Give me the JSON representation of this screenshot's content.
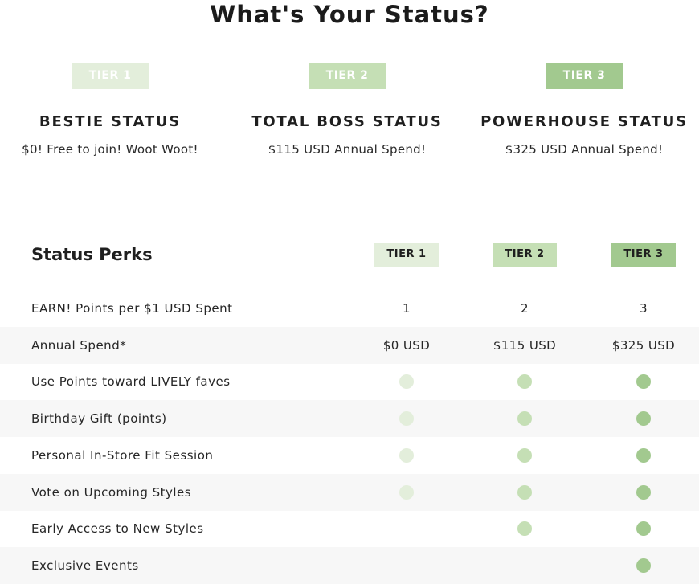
{
  "page_title": "What's Your Status?",
  "colors": {
    "tier1": "#e3eedb",
    "tier2": "#c5dfb5",
    "tier3": "#a2c98f"
  },
  "tiers": [
    {
      "badge": "TIER 1",
      "name": "BESTIE STATUS",
      "spend": "$0! Free to join! Woot Woot!"
    },
    {
      "badge": "TIER 2",
      "name": "TOTAL BOSS STATUS",
      "spend": "$115 USD Annual Spend!"
    },
    {
      "badge": "TIER 3",
      "name": "POWERHOUSE STATUS",
      "spend": "$325 USD Annual Spend!"
    }
  ],
  "perks": {
    "title": "Status Perks",
    "headers": [
      "TIER 1",
      "TIER 2",
      "TIER 3"
    ],
    "rows": [
      {
        "label": "EARN! Points per $1 USD Spent",
        "values": [
          "1",
          "2",
          "3"
        ]
      },
      {
        "label": "Annual Spend*",
        "values": [
          "$0 USD",
          "$115 USD",
          "$325 USD"
        ]
      },
      {
        "label": "Use Points toward LIVELY faves",
        "checks": [
          true,
          true,
          true
        ]
      },
      {
        "label": "Birthday Gift (points)",
        "checks": [
          true,
          true,
          true
        ]
      },
      {
        "label": "Personal In-Store Fit Session",
        "checks": [
          true,
          true,
          true
        ]
      },
      {
        "label": "Vote on Upcoming Styles",
        "checks": [
          true,
          true,
          true
        ]
      },
      {
        "label": "Early Access to New Styles",
        "checks": [
          false,
          true,
          true
        ]
      },
      {
        "label": "Exclusive Events",
        "checks": [
          false,
          false,
          true
        ]
      }
    ]
  }
}
